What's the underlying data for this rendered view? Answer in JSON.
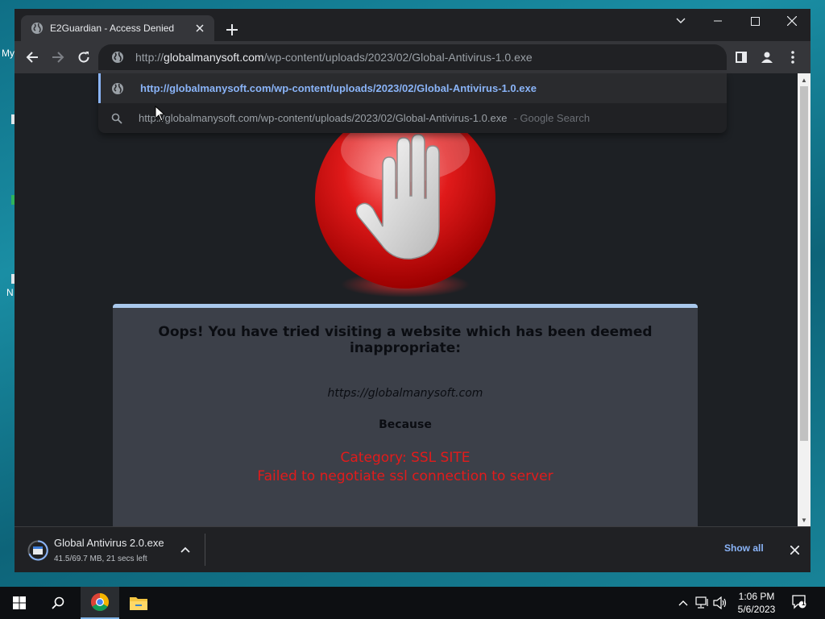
{
  "desktop": {
    "fragments": [
      "My",
      "N"
    ]
  },
  "browser": {
    "tab": {
      "title": "E2Guardian - Access Denied"
    },
    "omnibox": {
      "scheme": "http://",
      "host": "globalmanysoft.com",
      "path": "/wp-content/uploads/2023/02/Global-Antivirus-1.0.exe"
    },
    "suggestions": [
      {
        "text": "http://globalmanysoft.com/wp-content/uploads/2023/02/Global-Antivirus-1.0.exe",
        "suffix": ""
      },
      {
        "text": "http://globalmanysoft.com/wp-content/uploads/2023/02/Global-Antivirus-1.0.exe",
        "suffix": "- Google Search"
      }
    ]
  },
  "page": {
    "heading": "Oops! You have tried visiting a website which has been deemed inappropriate:",
    "blocked_url": "https://globalmanysoft.com",
    "because": "Because",
    "reason_lines": [
      "Category: SSL SITE",
      "Failed to negotiate ssl connection to server"
    ]
  },
  "download": {
    "filename": "Global Antivirus  2.0.exe",
    "status": "41.5/69.7 MB, 21 secs left",
    "show_all": "Show all"
  },
  "taskbar": {
    "time": "1:06 PM",
    "date": "5/6/2023",
    "notification_count": "1"
  },
  "colors": {
    "accent_blue": "#8ab4f8",
    "reason_red": "#e21b1b",
    "msgbox_bg": "#3c4049",
    "msgbox_border": "#a9c8ec"
  }
}
